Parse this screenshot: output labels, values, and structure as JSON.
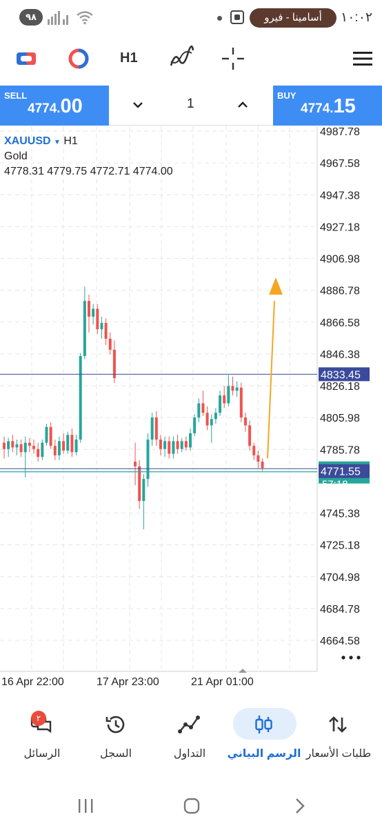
{
  "status_bar": {
    "time": "١٠:٠٢",
    "notification_pill": "أسامينا - فيرو",
    "battery": "٩٨"
  },
  "toolbar": {
    "timeframe": "H1",
    "icons": [
      "trade-manager-icon",
      "one-click-icon",
      "indicators-icon",
      "crosshair-icon",
      "menu-icon"
    ]
  },
  "trade_bar": {
    "sell_label": "SELL",
    "sell_price_main": "4774.",
    "sell_price_big": "00",
    "buy_label": "BUY",
    "buy_price_main": "4774.",
    "buy_price_big": "15",
    "lot": "1"
  },
  "chart": {
    "symbol": "XAUUSD",
    "timeframe": "H1",
    "description": "Gold",
    "ohlc": "4778.31 4779.75 4772.71 4774.00",
    "colors": {
      "bull": "#26a69a",
      "bear": "#ef5350",
      "grid": "#e6e6e6",
      "level_line": "#3b4a9a",
      "bid_line": "#26a69a",
      "arrow": "#f5a623"
    },
    "price_scale": [
      "4987.78",
      "4967.58",
      "4947.38",
      "4927.18",
      "4906.98",
      "4886.78",
      "4866.58",
      "4846.38",
      "4826.18",
      "4805.98",
      "4785.78",
      "4745.38",
      "4725.18",
      "4704.98",
      "4684.78",
      "4664.58"
    ],
    "level_label": "4833.45",
    "bid_label": "4771.55",
    "bid_sub_label": "57:18",
    "time_labels": [
      "16 Apr 22:00",
      "17 Apr 23:00",
      "21 Apr 01:00"
    ]
  },
  "chart_data": {
    "type": "candlestick",
    "symbol": "XAUUSD",
    "timeframe": "H1",
    "ylim": [
      4655,
      4995
    ],
    "horizontal_lines": [
      4833.45,
      4773.5,
      4771.55
    ],
    "candles": [
      {
        "o": 4790,
        "h": 4794,
        "l": 4780,
        "c": 4786
      },
      {
        "o": 4786,
        "h": 4793,
        "l": 4781,
        "c": 4791
      },
      {
        "o": 4791,
        "h": 4795,
        "l": 4784,
        "c": 4787
      },
      {
        "o": 4787,
        "h": 4792,
        "l": 4782,
        "c": 4789
      },
      {
        "o": 4789,
        "h": 4792,
        "l": 4781,
        "c": 4784
      },
      {
        "o": 4784,
        "h": 4794,
        "l": 4768,
        "c": 4790
      },
      {
        "o": 4790,
        "h": 4793,
        "l": 4784,
        "c": 4788
      },
      {
        "o": 4788,
        "h": 4792,
        "l": 4783,
        "c": 4786
      },
      {
        "o": 4786,
        "h": 4790,
        "l": 4778,
        "c": 4781
      },
      {
        "o": 4781,
        "h": 4792,
        "l": 4779,
        "c": 4790
      },
      {
        "o": 4790,
        "h": 4802,
        "l": 4788,
        "c": 4800
      },
      {
        "o": 4800,
        "h": 4803,
        "l": 4786,
        "c": 4788
      },
      {
        "o": 4788,
        "h": 4792,
        "l": 4779,
        "c": 4782
      },
      {
        "o": 4782,
        "h": 4794,
        "l": 4779,
        "c": 4791
      },
      {
        "o": 4791,
        "h": 4796,
        "l": 4783,
        "c": 4785
      },
      {
        "o": 4785,
        "h": 4797,
        "l": 4783,
        "c": 4795
      },
      {
        "o": 4795,
        "h": 4799,
        "l": 4781,
        "c": 4784
      },
      {
        "o": 4784,
        "h": 4795,
        "l": 4782,
        "c": 4792
      },
      {
        "o": 4792,
        "h": 4847,
        "l": 4790,
        "c": 4845
      },
      {
        "o": 4845,
        "h": 4889,
        "l": 4843,
        "c": 4880
      },
      {
        "o": 4880,
        "h": 4884,
        "l": 4860,
        "c": 4870
      },
      {
        "o": 4870,
        "h": 4878,
        "l": 4865,
        "c": 4875
      },
      {
        "o": 4875,
        "h": 4878,
        "l": 4859,
        "c": 4862
      },
      {
        "o": 4862,
        "h": 4870,
        "l": 4856,
        "c": 4866
      },
      {
        "o": 4866,
        "h": 4869,
        "l": 4852,
        "c": 4856
      },
      {
        "o": 4856,
        "h": 4860,
        "l": 4846,
        "c": 4849
      },
      {
        "o": 4849,
        "h": 4855,
        "l": 4828,
        "c": 4831
      },
      {
        "o": 4778,
        "h": 4790,
        "l": 4763,
        "c": 4775
      },
      {
        "o": 4775,
        "h": 4779,
        "l": 4748,
        "c": 4753
      },
      {
        "o": 4753,
        "h": 4770,
        "l": 4735,
        "c": 4767
      },
      {
        "o": 4767,
        "h": 4796,
        "l": 4762,
        "c": 4792
      },
      {
        "o": 4792,
        "h": 4809,
        "l": 4788,
        "c": 4806
      },
      {
        "o": 4806,
        "h": 4810,
        "l": 4788,
        "c": 4792
      },
      {
        "o": 4792,
        "h": 4795,
        "l": 4782,
        "c": 4786
      },
      {
        "o": 4786,
        "h": 4794,
        "l": 4781,
        "c": 4791
      },
      {
        "o": 4791,
        "h": 4794,
        "l": 4780,
        "c": 4783
      },
      {
        "o": 4783,
        "h": 4794,
        "l": 4780,
        "c": 4791
      },
      {
        "o": 4791,
        "h": 4795,
        "l": 4783,
        "c": 4786
      },
      {
        "o": 4786,
        "h": 4793,
        "l": 4784,
        "c": 4791
      },
      {
        "o": 4791,
        "h": 4794,
        "l": 4785,
        "c": 4787
      },
      {
        "o": 4787,
        "h": 4799,
        "l": 4785,
        "c": 4796
      },
      {
        "o": 4796,
        "h": 4808,
        "l": 4794,
        "c": 4806
      },
      {
        "o": 4806,
        "h": 4818,
        "l": 4803,
        "c": 4815
      },
      {
        "o": 4815,
        "h": 4823,
        "l": 4807,
        "c": 4809
      },
      {
        "o": 4809,
        "h": 4813,
        "l": 4798,
        "c": 4801
      },
      {
        "o": 4801,
        "h": 4808,
        "l": 4790,
        "c": 4805
      },
      {
        "o": 4805,
        "h": 4812,
        "l": 4802,
        "c": 4809
      },
      {
        "o": 4809,
        "h": 4823,
        "l": 4807,
        "c": 4820
      },
      {
        "o": 4820,
        "h": 4826,
        "l": 4812,
        "c": 4815
      },
      {
        "o": 4815,
        "h": 4833,
        "l": 4813,
        "c": 4826
      },
      {
        "o": 4826,
        "h": 4832,
        "l": 4820,
        "c": 4823
      },
      {
        "o": 4823,
        "h": 4829,
        "l": 4819,
        "c": 4825
      },
      {
        "o": 4825,
        "h": 4828,
        "l": 4803,
        "c": 4806
      },
      {
        "o": 4806,
        "h": 4809,
        "l": 4797,
        "c": 4801
      },
      {
        "o": 4801,
        "h": 4804,
        "l": 4785,
        "c": 4788
      },
      {
        "o": 4788,
        "h": 4790,
        "l": 4779,
        "c": 4782
      },
      {
        "o": 4782,
        "h": 4785,
        "l": 4774,
        "c": 4778
      },
      {
        "o": 4778,
        "h": 4780,
        "l": 4772,
        "c": 4774
      }
    ]
  },
  "bottom_nav": {
    "items": [
      {
        "label": "طلبات الأسعار"
      },
      {
        "label": "الرسم البياني"
      },
      {
        "label": "التداول"
      },
      {
        "label": "السجل"
      },
      {
        "label": "الرسائل"
      }
    ],
    "messages_badge": "٢"
  }
}
